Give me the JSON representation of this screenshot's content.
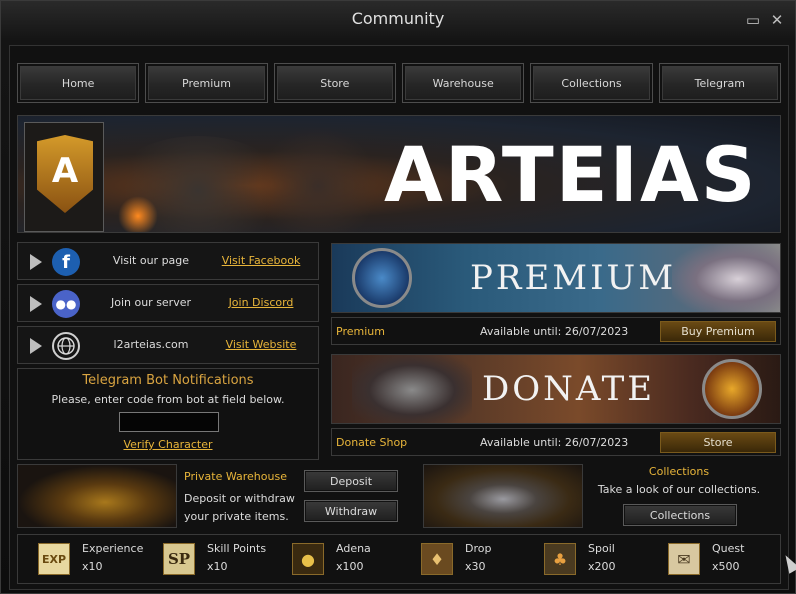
{
  "window": {
    "title": "Community"
  },
  "nav": [
    "Home",
    "Premium",
    "Store",
    "Warehouse",
    "Collections",
    "Telegram"
  ],
  "banner": {
    "emblem_letter": "A",
    "brand": "ARTEIAS"
  },
  "social": [
    {
      "icon": "facebook-icon",
      "label": "Visit our page",
      "link": "Visit Facebook",
      "color": "#1d5fb0"
    },
    {
      "icon": "discord-icon",
      "label": "Join our server",
      "link": "Join Discord",
      "color": "#4a63c8"
    },
    {
      "icon": "globe-icon",
      "label": "l2arteias.com",
      "link": "Visit Website",
      "color": "#1a1a1a"
    }
  ],
  "telegram": {
    "title": "Telegram Bot Notifications",
    "subtitle": "Please, enter code from bot at field below.",
    "code_value": "",
    "verify": "Verify Character"
  },
  "premium": {
    "banner_text": "PREMIUM",
    "name": "Premium",
    "available": "Available until: 26/07/2023",
    "button": "Buy Premium"
  },
  "donate": {
    "banner_text": "DONATE",
    "name": "Donate Shop",
    "available": "Available until: 26/07/2023",
    "button": "Store"
  },
  "warehouse": {
    "title": "Private Warehouse",
    "description": "Deposit or withdraw your private items.",
    "deposit": "Deposit",
    "withdraw": "Withdraw"
  },
  "collections": {
    "title": "Collections",
    "description": "Take a look of our collections.",
    "button": "Collections"
  },
  "rates": [
    {
      "icon": "experience-icon",
      "glyph": "EXP",
      "name": "Experience",
      "value": "x10"
    },
    {
      "icon": "skill-points-icon",
      "glyph": "SP",
      "name": "Skill Points",
      "value": "x10"
    },
    {
      "icon": "adena-icon",
      "glyph": "●",
      "name": "Adena",
      "value": "x100"
    },
    {
      "icon": "drop-icon",
      "glyph": "♦",
      "name": "Drop",
      "value": "x30"
    },
    {
      "icon": "spoil-icon",
      "glyph": "♣",
      "name": "Spoil",
      "value": "x200"
    },
    {
      "icon": "quest-icon",
      "glyph": "✉",
      "name": "Quest",
      "value": "x500"
    }
  ],
  "colors": {
    "accent": "#e8b53a",
    "title_gold": "#d9a441",
    "button_gold": "#6a4a14"
  }
}
